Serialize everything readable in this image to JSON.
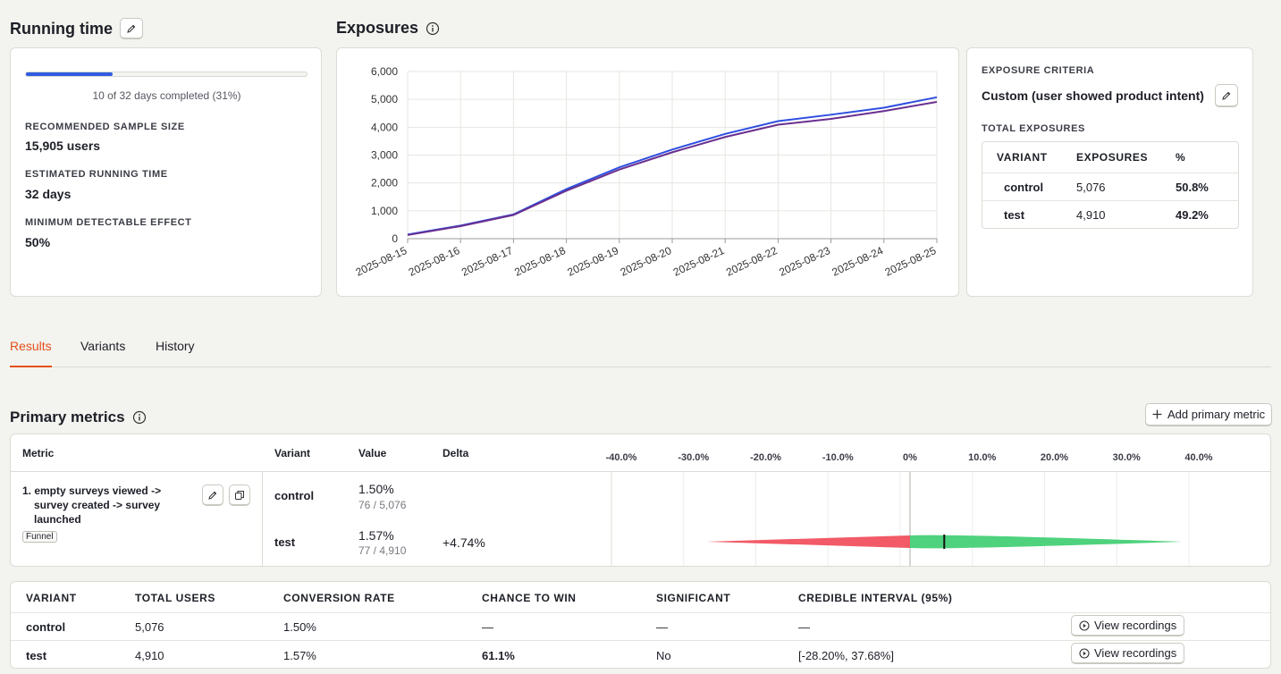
{
  "running_time": {
    "title": "Running time",
    "progress_text": "10 of 32 days completed (31%)",
    "progress_fraction": 0.31,
    "recommended_label": "RECOMMENDED SAMPLE SIZE",
    "recommended_value": "15,905 users",
    "estimated_label": "ESTIMATED RUNNING TIME",
    "estimated_value": "32 days",
    "mde_label": "MINIMUM DETECTABLE EFFECT",
    "mde_value": "50%"
  },
  "exposures": {
    "title": "Exposures",
    "criteria_label": "EXPOSURE CRITERIA",
    "criteria_value": "Custom (user showed product intent)",
    "total_label": "TOTAL EXPOSURES",
    "table_headers": [
      "VARIANT",
      "EXPOSURES",
      "%"
    ],
    "table_rows": [
      {
        "variant": "control",
        "exposures": "5,076",
        "pct": "50.8%"
      },
      {
        "variant": "test",
        "exposures": "4,910",
        "pct": "49.2%"
      }
    ]
  },
  "chart_data": {
    "type": "line",
    "x": [
      "2025-08-15",
      "2025-08-16",
      "2025-08-17",
      "2025-08-18",
      "2025-08-19",
      "2025-08-20",
      "2025-08-21",
      "2025-08-22",
      "2025-08-23",
      "2025-08-24",
      "2025-08-25"
    ],
    "y_ticks": [
      "6,000",
      "5,000",
      "4,000",
      "3,000",
      "2,000",
      "1,000",
      "0"
    ],
    "ylim": [
      0,
      6000
    ],
    "grid": true,
    "series": [
      {
        "color": "#2f4fe0",
        "values": [
          150,
          470,
          870,
          1780,
          2560,
          3200,
          3760,
          4220,
          4450,
          4700,
          5076
        ]
      },
      {
        "color": "#6a2f8f",
        "values": [
          130,
          450,
          850,
          1720,
          2480,
          3100,
          3650,
          4090,
          4300,
          4580,
          4910
        ]
      }
    ]
  },
  "tabs": [
    {
      "label": "Results",
      "active": true
    },
    {
      "label": "Variants",
      "active": false
    },
    {
      "label": "History",
      "active": false
    }
  ],
  "primary_metrics": {
    "title": "Primary metrics",
    "add_button": "Add primary metric",
    "headers": {
      "metric": "Metric",
      "variant": "Variant",
      "value": "Value",
      "delta": "Delta"
    },
    "axis_ticks": [
      "-40.0%",
      "-30.0%",
      "-20.0%",
      "-10.0%",
      "0%",
      "10.0%",
      "20.0%",
      "30.0%",
      "40.0%"
    ],
    "metric_name": "1. empty surveys viewed -> survey created -> survey launched",
    "metric_line1": "1. empty surveys viewed ->",
    "metric_line2": "survey created -> survey",
    "metric_line3": "launched",
    "metric_type": "Funnel",
    "rows": [
      {
        "variant": "control",
        "value": "1.50%",
        "sub": "76 / 5,076",
        "delta": ""
      },
      {
        "variant": "test",
        "value": "1.57%",
        "sub": "77 / 4,910",
        "delta": "+4.74%"
      }
    ],
    "interval": {
      "low": -28.2,
      "high": 37.68,
      "mean": 4.74
    }
  },
  "results_table": {
    "headers": [
      "VARIANT",
      "TOTAL USERS",
      "CONVERSION RATE",
      "CHANCE TO WIN",
      "SIGNIFICANT",
      "CREDIBLE INTERVAL (95%)"
    ],
    "rows": [
      {
        "variant": "control",
        "users": "5,076",
        "rate": "1.50%",
        "chance": "—",
        "significant": "—",
        "interval": "—",
        "button": "View recordings"
      },
      {
        "variant": "test",
        "users": "4,910",
        "rate": "1.57%",
        "chance": "61.1%",
        "significant": "No",
        "interval": "[-28.20%, 37.68%]",
        "button": "View recordings"
      }
    ]
  },
  "colors": {
    "accent": "#e4501c",
    "progress": "#2f5ce0",
    "negative": "#f25a67",
    "positive": "#4fd27e"
  }
}
